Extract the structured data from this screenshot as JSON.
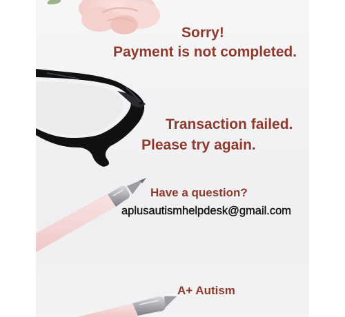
{
  "messages": {
    "title": "Sorry!",
    "subtitle": "Payment is not completed.",
    "failure_line1": "Transaction failed.",
    "failure_line2": "Please try again.",
    "question": "Have a question?",
    "email": "aplusautismhelpdesk@gmail.com",
    "organization": "A+ Autism"
  },
  "colors": {
    "heading_red": "#8e3a2c",
    "email_black": "#111111",
    "side_margin": "#ffffff",
    "photo_background": "#f2f2f4"
  },
  "decorations": {
    "flower": "rose-image",
    "glasses": "glasses-image",
    "pen_upper": "pen-image",
    "pen_lower": "pen-image"
  }
}
